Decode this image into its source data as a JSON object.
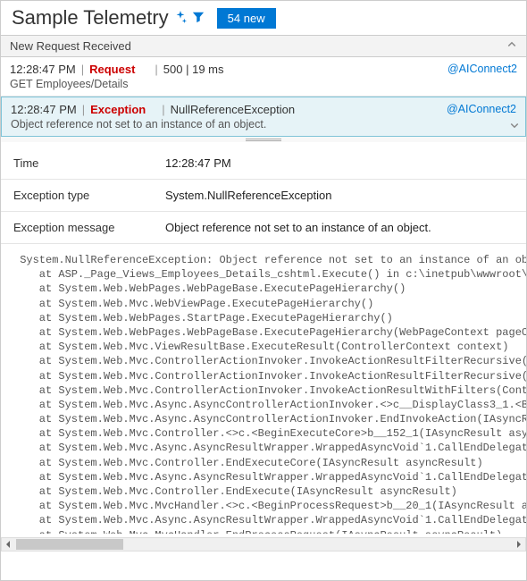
{
  "header": {
    "title": "Sample Telemetry",
    "new_badge": "54 new"
  },
  "group": {
    "title": "New Request Received"
  },
  "events": [
    {
      "time": "12:28:47 PM",
      "kind": "Request",
      "summary": "500 | 19 ms",
      "detail": "GET Employees/Details",
      "host": "@AIConnect2"
    },
    {
      "time": "12:28:47 PM",
      "kind": "Exception",
      "summary": "NullReferenceException",
      "detail": "Object reference not set to an instance of an object.",
      "host": "@AIConnect2"
    }
  ],
  "details": {
    "time_label": "Time",
    "time_value": "12:28:47 PM",
    "type_label": "Exception type",
    "type_value": "System.NullReferenceException",
    "msg_label": "Exception message",
    "msg_value": "Object reference not set to an instance of an object."
  },
  "stacktrace": " System.NullReferenceException: Object reference not set to an instance of an object\n    at ASP._Page_Views_Employees_Details_cshtml.Execute() in c:\\inetpub\\wwwroot\\Fabr\n    at System.Web.WebPages.WebPageBase.ExecutePageHierarchy()\n    at System.Web.Mvc.WebViewPage.ExecutePageHierarchy()\n    at System.Web.WebPages.StartPage.ExecutePageHierarchy()\n    at System.Web.WebPages.WebPageBase.ExecutePageHierarchy(WebPageContext pageConte\n    at System.Web.Mvc.ViewResultBase.ExecuteResult(ControllerContext context)\n    at System.Web.Mvc.ControllerActionInvoker.InvokeActionResultFilterRecursive(ILis\n    at System.Web.Mvc.ControllerActionInvoker.InvokeActionResultFilterRecursive(ILis\n    at System.Web.Mvc.ControllerActionInvoker.InvokeActionResultWithFilters(Controll\n    at System.Web.Mvc.Async.AsyncControllerActionInvoker.<>c__DisplayClass3_1.<Begin\n    at System.Web.Mvc.Async.AsyncControllerActionInvoker.EndInvokeAction(IAsyncResul\n    at System.Web.Mvc.Controller.<>c.<BeginExecuteCore>b__152_1(IAsyncResult asyncRe\n    at System.Web.Mvc.Async.AsyncResultWrapper.WrappedAsyncVoid`1.CallEndDelegate(IA\n    at System.Web.Mvc.Controller.EndExecuteCore(IAsyncResult asyncResult)\n    at System.Web.Mvc.Async.AsyncResultWrapper.WrappedAsyncVoid`1.CallEndDelegate(IA\n    at System.Web.Mvc.Controller.EndExecute(IAsyncResult asyncResult)\n    at System.Web.Mvc.MvcHandler.<>c.<BeginProcessRequest>b__20_1(IAsyncResult async\n    at System.Web.Mvc.Async.AsyncResultWrapper.WrappedAsyncVoid`1.CallEndDelegate(IA\n    at System.Web.Mvc.MvcHandler.EndProcessRequest(IAsyncResult asyncResult)\n    at System.Web.HttpApplication.CallHandlerExecutionStep.System.Web.HttpApplicatio\n    at System.Web.HttpApplication.ExecuteStep(IExecutionStep step, Boolean& complete"
}
